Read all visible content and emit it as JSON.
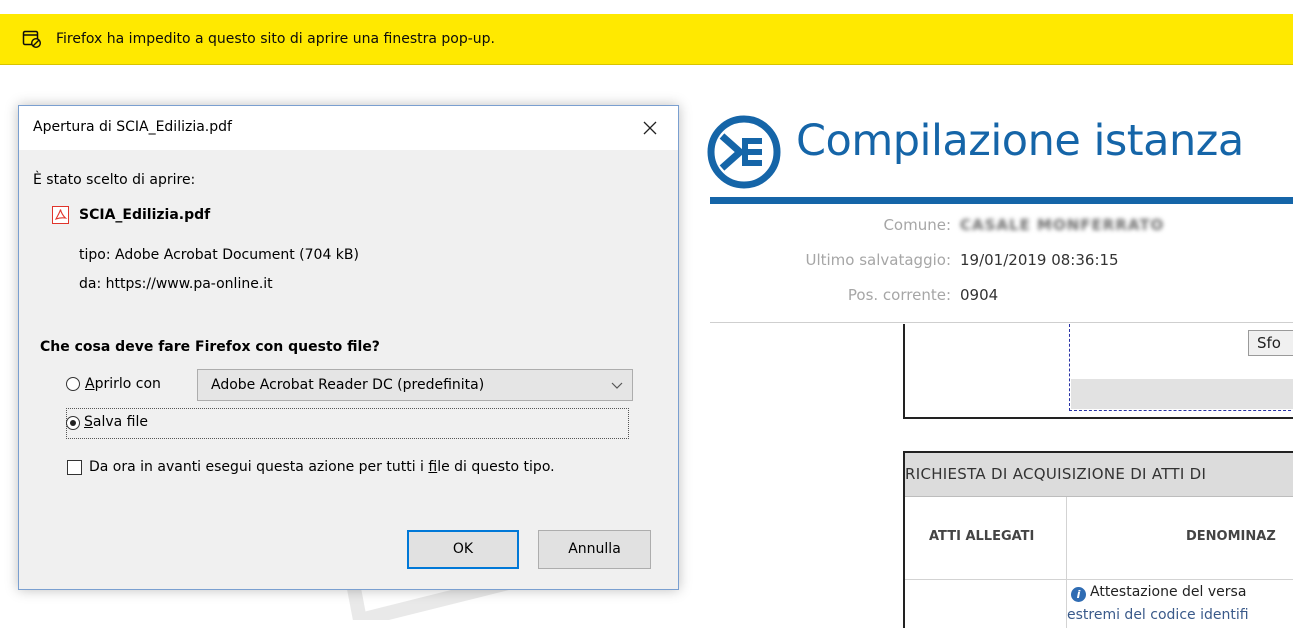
{
  "notification": {
    "message": "Firefox ha impedito a questo sito di aprire una finestra pop-up.",
    "icon": "popup-blocked-icon",
    "color": "#ffe900"
  },
  "page": {
    "title": "Compilazione istanza",
    "logo_icon": "compilazione-logo-icon",
    "accent_color": "#1565a8",
    "info": [
      {
        "label": "Comune:",
        "value": "CASALE MONFERRATO"
      },
      {
        "label": "Ultimo salvataggio:",
        "value": "19/01/2019 08:36:15"
      },
      {
        "label": "Pos. corrente:",
        "value": "0904"
      }
    ],
    "browse_button": "Sfo",
    "table": {
      "header": "RICHIESTA DI ACQUISIZIONE DI ATTI DI",
      "col1": "ATTI ALLEGATI",
      "col2": "DENOMINAZ",
      "row_text": "Attestazione del versa",
      "row_subtext": "estremi del codice identifi"
    }
  },
  "dialog": {
    "title": "Apertura di SCIA_Edilizia.pdf",
    "intro": "È stato scelto di aprire:",
    "file_name": "SCIA_Edilizia.pdf",
    "type_label": "tipo:",
    "type_value": "Adobe Acrobat Document (704 kB)",
    "from_label": "da:",
    "from_value": "https://www.pa-online.it",
    "question": "Che cosa deve fare Firefox con questo file?",
    "open_with_prefix": "A",
    "open_with_rest": "prirlo con",
    "open_with_app": "Adobe Acrobat Reader DC  (predefinita)",
    "save_prefix": "S",
    "save_rest": "alva file",
    "selected_option": "save",
    "remember_pre": "Da ora in avanti esegui questa azione per tutti i ",
    "remember_u": "f",
    "remember_post": "ile di questo tipo.",
    "ok_label": "OK",
    "cancel_label": "Annulla",
    "close_icon": "close-icon"
  }
}
